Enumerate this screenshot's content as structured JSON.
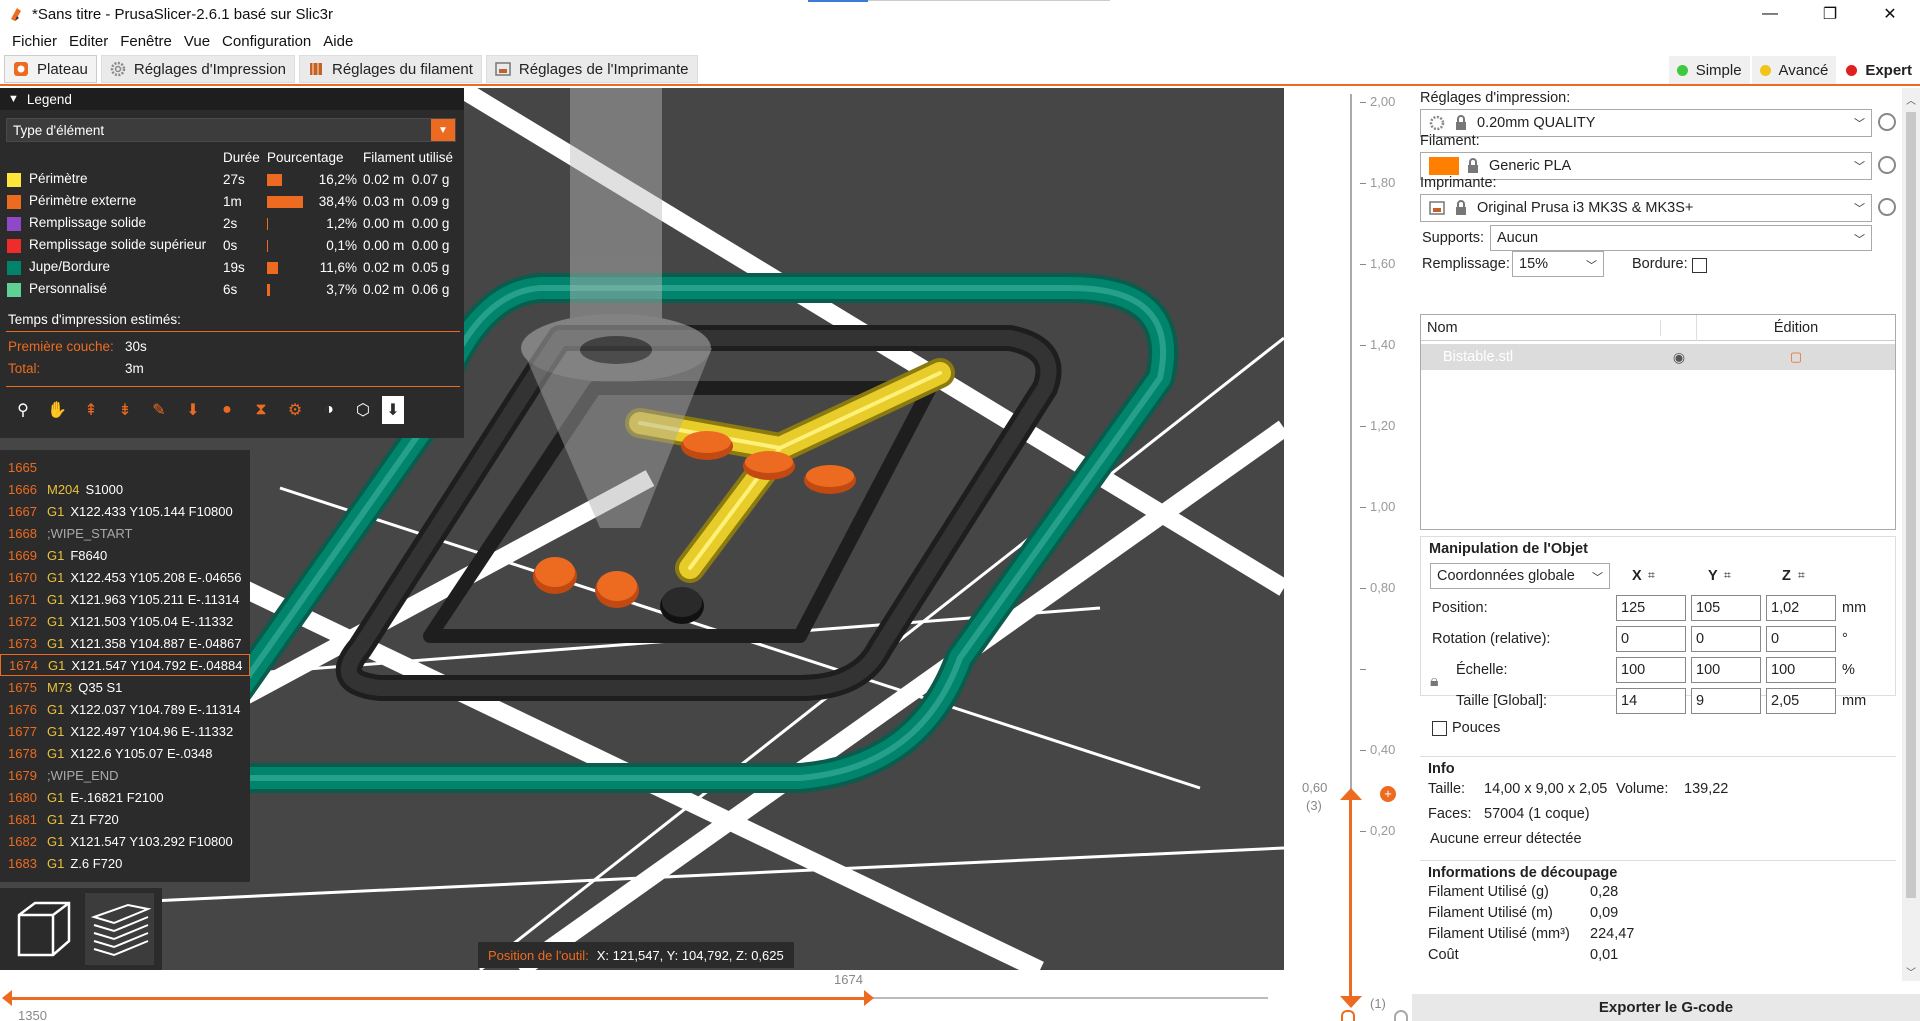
{
  "window": {
    "title": "*Sans titre - PrusaSlicer-2.6.1 basé sur Slic3r",
    "minimize": "—",
    "maximize": "❐",
    "close": "✕"
  },
  "menu": [
    "Fichier",
    "Editer",
    "Fenêtre",
    "Vue",
    "Configuration",
    "Aide"
  ],
  "tabs": [
    {
      "label": "Plateau",
      "active": true
    },
    {
      "label": "Réglages d'Impression"
    },
    {
      "label": "Réglages du filament"
    },
    {
      "label": "Réglages de l'Imprimante"
    }
  ],
  "modes": [
    {
      "label": "Simple",
      "color": "#3ec93e"
    },
    {
      "label": "Avancé",
      "color": "#f0c419"
    },
    {
      "label": "Expert",
      "color": "#e02020",
      "active": true
    }
  ],
  "legend": {
    "header": "Legend",
    "type_select": "Type d'élément",
    "columns": [
      "Durée",
      "Pourcentage",
      "Filament utilisé"
    ],
    "rows": [
      {
        "color": "#ffe639",
        "name": "Périmètre",
        "time": "27s",
        "pct": "16,2%",
        "pct_value": 16.2,
        "len": "0.02 m",
        "weight": "0.07 g"
      },
      {
        "color": "#ed6b21",
        "name": "Périmètre externe",
        "time": "1m",
        "pct": "38,4%",
        "pct_value": 38.4,
        "len": "0.03 m",
        "weight": "0.09 g"
      },
      {
        "color": "#8f49c8",
        "name": "Remplissage solide",
        "time": "2s",
        "pct": "1,2%",
        "pct_value": 1.2,
        "len": "0.00 m",
        "weight": "0.00 g"
      },
      {
        "color": "#f02b2b",
        "name": "Remplissage solide supérieur",
        "time": "0s",
        "pct": "0,1%",
        "pct_value": 0.1,
        "len": "0.00 m",
        "weight": "0.00 g"
      },
      {
        "color": "#00846c",
        "name": "Jupe/Bordure",
        "time": "19s",
        "pct": "11,6%",
        "pct_value": 11.6,
        "len": "0.02 m",
        "weight": "0.05 g"
      },
      {
        "color": "#5ed194",
        "name": "Personnalisé",
        "time": "6s",
        "pct": "3,7%",
        "pct_value": 3.7,
        "len": "0.02 m",
        "weight": "0.06 g"
      }
    ],
    "estimated_label": "Temps d'impression estimés:",
    "first_layer_label": "Première couche:",
    "first_layer_value": "30s",
    "total_label": "Total:",
    "total_value": "3m",
    "tool_icons": [
      "travel-icon",
      "wipe-icon",
      "retractions-icon",
      "deretractions-icon",
      "seams-icon",
      "tool-changes-icon",
      "color-changes-icon",
      "pause-prints-icon",
      "custom-gcodes-icon",
      "center-of-gravity-icon",
      "shells-icon",
      "tool-marker-icon"
    ]
  },
  "gcode": [
    {
      "num": "1665",
      "cmd": "",
      "args": ""
    },
    {
      "num": "1666",
      "cmd": "M204",
      "args": "S1000"
    },
    {
      "num": "1667",
      "cmd": "G1",
      "args": "X122.433 Y105.144 F10800"
    },
    {
      "num": "1668",
      "cmd": "",
      "args": ";WIPE_START",
      "comment": true
    },
    {
      "num": "1669",
      "cmd": "G1",
      "args": "F8640"
    },
    {
      "num": "1670",
      "cmd": "G1",
      "args": "X122.453 Y105.208 E-.04656"
    },
    {
      "num": "1671",
      "cmd": "G1",
      "args": "X121.963 Y105.211 E-.11314"
    },
    {
      "num": "1672",
      "cmd": "G1",
      "args": "X121.503 Y105.04 E-.11332"
    },
    {
      "num": "1673",
      "cmd": "G1",
      "args": "X121.358 Y104.887 E-.04867"
    },
    {
      "num": "1674",
      "cmd": "G1",
      "args": "X121.547 Y104.792 E-.04884",
      "current": true
    },
    {
      "num": "1675",
      "cmd": "M73",
      "args": "Q35 S1"
    },
    {
      "num": "1676",
      "cmd": "G1",
      "args": "X122.037 Y104.789 E-.11314"
    },
    {
      "num": "1677",
      "cmd": "G1",
      "args": "X122.497 Y104.96 E-.11332"
    },
    {
      "num": "1678",
      "cmd": "G1",
      "args": "X122.6 Y105.07 E-.0348"
    },
    {
      "num": "1679",
      "cmd": "",
      "args": ";WIPE_END",
      "comment": true
    },
    {
      "num": "1680",
      "cmd": "G1",
      "args": "E-.16821 F2100"
    },
    {
      "num": "1681",
      "cmd": "G1",
      "args": "Z1 F720"
    },
    {
      "num": "1682",
      "cmd": "G1",
      "args": "X121.547 Y103.292 F10800"
    },
    {
      "num": "1683",
      "cmd": "G1",
      "args": "Z.6 F720"
    }
  ],
  "tool_position": {
    "label": "Position de l'outil:",
    "value": "X: 121,547, Y: 104,792, Z: 0,625"
  },
  "hslider": {
    "current": "1674",
    "start": "1350"
  },
  "vslider": {
    "ticks": [
      "2,00",
      "1,80",
      "1,60",
      "1,40",
      "1,20",
      "1,00",
      "0,80",
      "0,60",
      "0,40",
      "0,20"
    ],
    "current_label": "0,60",
    "current_layer": "(3)",
    "bottom_layer": "(1)"
  },
  "right": {
    "print_settings_label": "Réglages d'impression:",
    "print_settings_value": "0.20mm QUALITY",
    "filament_label": "Filament:",
    "filament_value": "Generic PLA",
    "filament_color": "#ff8000",
    "printer_label": "Imprimante:",
    "printer_value": "Original Prusa i3 MK3S & MK3S+",
    "supports_label": "Supports:",
    "supports_value": "Aucun",
    "infill_label": "Remplissage:",
    "infill_value": "15%",
    "brim_label": "Bordure:",
    "objlist": {
      "col_name": "Nom",
      "col_edit": "Édition",
      "item": "Bistable.stl"
    },
    "manip": {
      "title": "Manipulation de l'Objet",
      "coord_value": "Coordonnées globale",
      "axes": [
        "X",
        "Y",
        "Z"
      ],
      "position_label": "Position:",
      "position": [
        "125",
        "105",
        "1,02"
      ],
      "position_unit": "mm",
      "rotation_label": "Rotation (relative):",
      "rotation": [
        "0",
        "0",
        "0"
      ],
      "rotation_unit": "°",
      "scale_label": "Échelle:",
      "scale": [
        "100",
        "100",
        "100"
      ],
      "scale_unit": "%",
      "size_label": "Taille [Global]:",
      "size": [
        "14",
        "9",
        "2,05"
      ],
      "size_unit": "mm",
      "inches_label": "Pouces"
    },
    "info": {
      "title": "Info",
      "size_label": "Taille:",
      "size_value": "14,00 x 9,00 x 2,05",
      "volume_label": "Volume:",
      "volume_value": "139,22",
      "faces_label": "Faces:",
      "faces_value": "57004 (1 coque)",
      "errors": "Aucune erreur détectée"
    },
    "slice_info": {
      "title": "Informations de découpage",
      "rows": [
        {
          "label": "Filament Utilisé (g)",
          "value": "0,28"
        },
        {
          "label": "Filament Utilisé (m)",
          "value": "0,09"
        },
        {
          "label": "Filament Utilisé (mm³)",
          "value": "224,47"
        },
        {
          "label": "Coût",
          "value": "0,01"
        }
      ]
    },
    "export_button": "Exporter le G-code"
  }
}
